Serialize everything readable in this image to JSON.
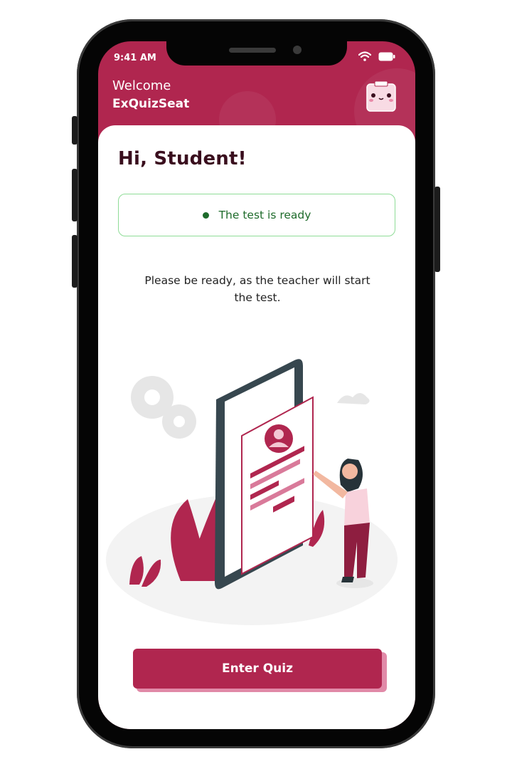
{
  "status_bar": {
    "time": "9:41 AM"
  },
  "header": {
    "welcome": "Welcome",
    "app_name": "ExQuizSeat"
  },
  "main": {
    "greeting": "Hi, Student!",
    "status": "The test is ready",
    "message": "Please be ready, as the teacher will start the test.",
    "enter_button": "Enter Quiz"
  },
  "colors": {
    "brand": "#b0264f",
    "brand_light": "#e18aa8",
    "ready_green": "#1e6b2b",
    "ready_border": "#8fdc97"
  },
  "icons": [
    "wifi-icon",
    "battery-icon",
    "mascot-icon",
    "status-dot-icon"
  ]
}
